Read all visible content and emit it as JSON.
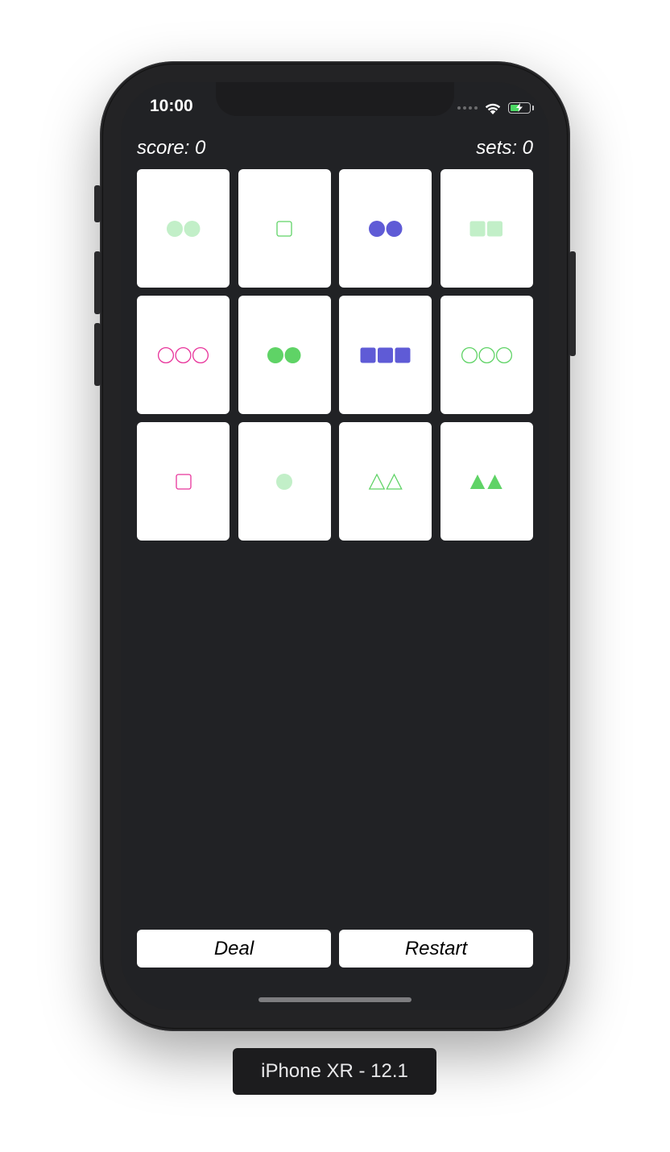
{
  "status_bar": {
    "time": "10:00",
    "icons": [
      "signal-dots-icon",
      "wifi-icon",
      "battery-charging-icon"
    ]
  },
  "header": {
    "score_text": "score: 0",
    "sets_text": "sets: 0"
  },
  "colors": {
    "light_green": "#c2efc8",
    "green": "#5fd366",
    "purple": "#5f5bd6",
    "pink": "#e8349b",
    "screen_bg": "#212225",
    "card_bg": "#ffffff"
  },
  "cards": [
    {
      "count": 2,
      "shape": "circle",
      "fill": "solid",
      "color": "#c2efc8"
    },
    {
      "count": 1,
      "shape": "square",
      "fill": "outline",
      "color": "#5fd366"
    },
    {
      "count": 2,
      "shape": "circle",
      "fill": "solid",
      "color": "#5f5bd6"
    },
    {
      "count": 2,
      "shape": "square",
      "fill": "solid",
      "color": "#c2efc8"
    },
    {
      "count": 3,
      "shape": "circle",
      "fill": "outline",
      "color": "#e8349b"
    },
    {
      "count": 2,
      "shape": "circle",
      "fill": "solid",
      "color": "#5fd366"
    },
    {
      "count": 3,
      "shape": "square",
      "fill": "solid",
      "color": "#5f5bd6"
    },
    {
      "count": 3,
      "shape": "circle",
      "fill": "outline",
      "color": "#5fd366"
    },
    {
      "count": 1,
      "shape": "square",
      "fill": "outline",
      "color": "#e8349b"
    },
    {
      "count": 1,
      "shape": "circle",
      "fill": "solid",
      "color": "#c2efc8"
    },
    {
      "count": 2,
      "shape": "triangle",
      "fill": "outline",
      "color": "#5fd366"
    },
    {
      "count": 2,
      "shape": "triangle",
      "fill": "solid",
      "color": "#5fd366"
    }
  ],
  "buttons": {
    "deal_label": "Deal",
    "restart_label": "Restart"
  },
  "simulator_label": "iPhone XR - 12.1"
}
